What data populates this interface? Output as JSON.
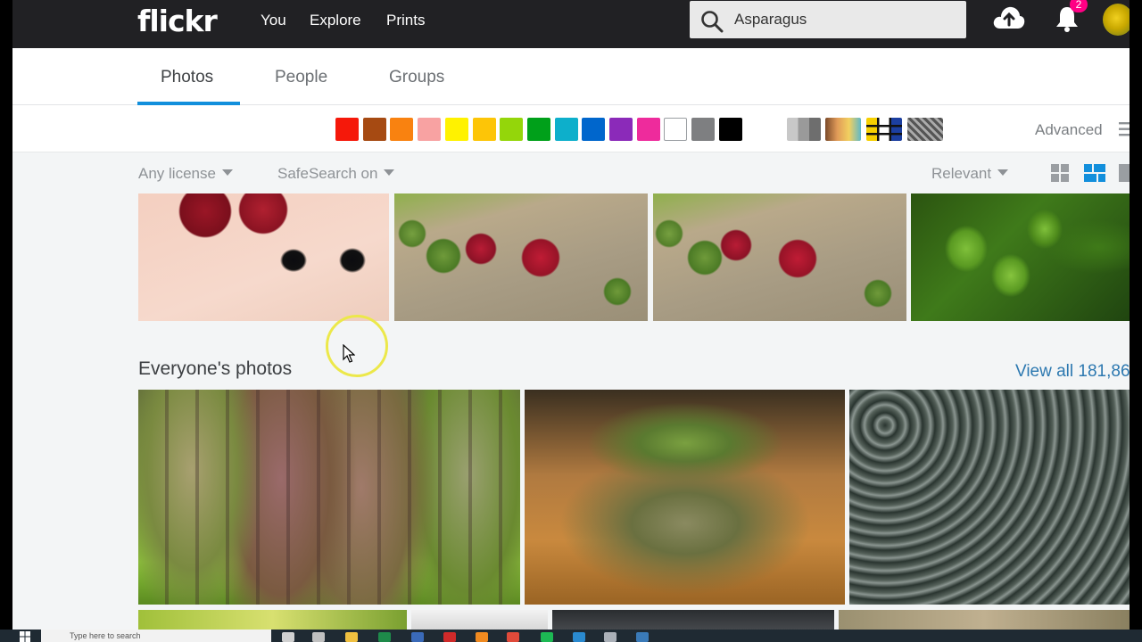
{
  "nav": {
    "logo": "flickr",
    "links": [
      "You",
      "Explore",
      "Prints"
    ],
    "search_value": "Asparagus",
    "notification_count": "2"
  },
  "tabs": [
    {
      "label": "Photos",
      "active": true
    },
    {
      "label": "People",
      "active": false
    },
    {
      "label": "Groups",
      "active": false
    }
  ],
  "color_filters": [
    "#f5180a",
    "#a64a12",
    "#f98210",
    "#f8a2a2",
    "#fff200",
    "#fdc507",
    "#94d60a",
    "#00a01a",
    "#0dafcb",
    "#0066cc",
    "#8b2ab9",
    "#ee2b9c",
    "#ffffff",
    "#7e7f81",
    "#000000"
  ],
  "advanced_label": "Advanced",
  "filters": {
    "license": "Any license",
    "safesearch": "SafeSearch on",
    "sort": "Relevant"
  },
  "section": {
    "title": "Everyone's photos",
    "view_all": "View all 181,86"
  },
  "taskbar": {
    "search_placeholder": "Type here to search"
  }
}
